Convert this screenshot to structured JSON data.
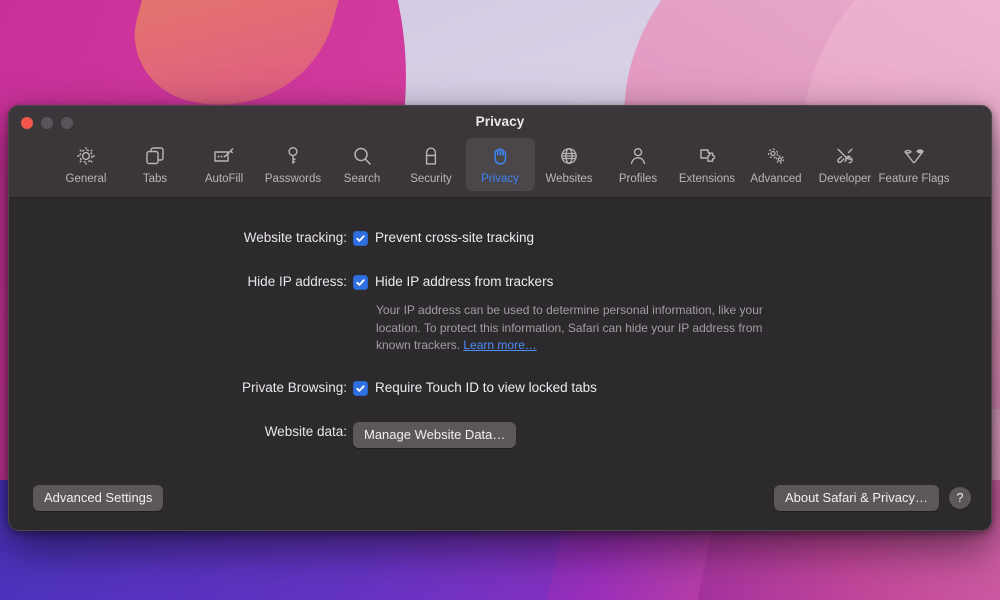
{
  "window": {
    "title": "Privacy",
    "traffic_lights": [
      {
        "name": "close",
        "color": "#f2564c"
      },
      {
        "name": "minimize",
        "color": "#58545a"
      },
      {
        "name": "zoom",
        "color": "#58545a"
      }
    ]
  },
  "toolbar": {
    "tabs": [
      {
        "label": "General",
        "icon": "gear-icon",
        "selected": false
      },
      {
        "label": "Tabs",
        "icon": "tabs-icon",
        "selected": false
      },
      {
        "label": "AutoFill",
        "icon": "autofill-icon",
        "selected": false
      },
      {
        "label": "Passwords",
        "icon": "key-icon",
        "selected": false
      },
      {
        "label": "Search",
        "icon": "magnifier-icon",
        "selected": false
      },
      {
        "label": "Security",
        "icon": "lock-icon",
        "selected": false
      },
      {
        "label": "Privacy",
        "icon": "hand-icon",
        "selected": true
      },
      {
        "label": "Websites",
        "icon": "globe-icon",
        "selected": false
      },
      {
        "label": "Profiles",
        "icon": "person-icon",
        "selected": false
      },
      {
        "label": "Extensions",
        "icon": "puzzle-piece-icon",
        "selected": false
      },
      {
        "label": "Advanced",
        "icon": "gears-icon",
        "selected": false
      },
      {
        "label": "Developer",
        "icon": "tools-icon",
        "selected": false
      },
      {
        "label": "Feature Flags",
        "icon": "flags-icon",
        "selected": false
      }
    ]
  },
  "main": {
    "rows": {
      "website_tracking": {
        "label": "Website tracking:",
        "checkbox_label": "Prevent cross-site tracking",
        "checked": true
      },
      "hide_ip": {
        "label": "Hide IP address:",
        "checkbox_label": "Hide IP address from trackers",
        "checked": true
      },
      "private_browsing": {
        "label": "Private Browsing:",
        "checkbox_label": "Require Touch ID to view locked tabs",
        "checked": true
      },
      "website_data": {
        "label": "Website data:",
        "button_label": "Manage Website Data…"
      }
    },
    "hint": {
      "text": "Your IP address can be used to determine personal information, like your location. To protect this information, Safari can hide your IP address from known trackers. ",
      "link_label": "Learn more…"
    }
  },
  "bottom_bar": {
    "advanced_settings_label": "Advanced Settings",
    "about_label": "About Safari & Privacy…",
    "help_label": "?"
  },
  "colors": {
    "accent_blue": "#3d84f2",
    "checkbox_blue": "#2f6fe0",
    "link_blue": "#4c8ef5",
    "window_bg": "#2d2a2e",
    "toolbar_bg": "#3a3639",
    "selected_tab_bg": "#4a4649",
    "button_bg": "#5b575b"
  }
}
